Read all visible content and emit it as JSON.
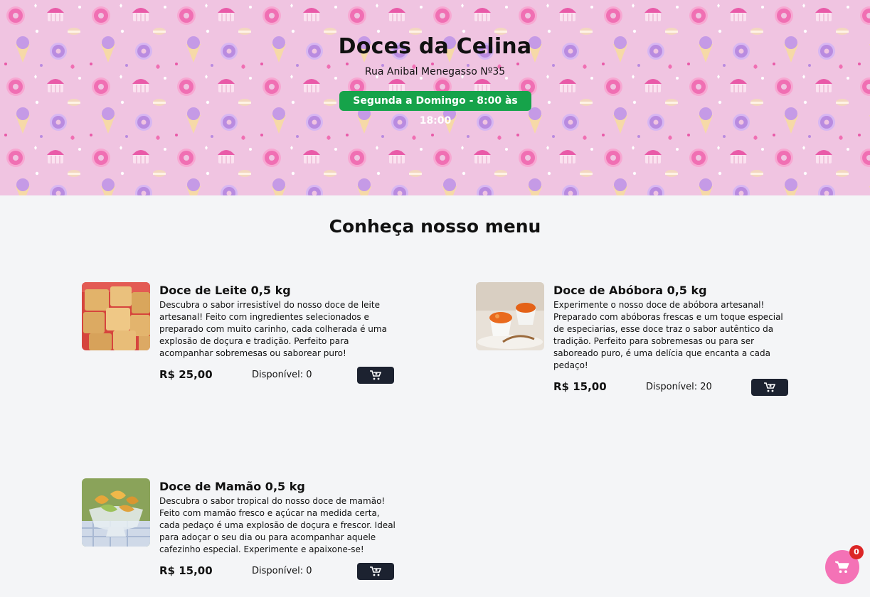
{
  "header": {
    "title": "Doces da Celina",
    "address": "Rua Anibal Menegasso Nº35",
    "hours": "Segunda a Domingo - 8:00 às 18:00"
  },
  "menu": {
    "title": "Conheça nosso menu",
    "products": [
      {
        "name": "Doce de Leite 0,5 kg",
        "description": "Descubra o sabor irresistível do nosso doce de leite artesanal! Feito com ingredientes selecionados e preparado com muito carinho, cada colherada é uma explosão de doçura e tradição. Perfeito para acompanhar sobremesas ou saborear puro!",
        "price": "R$ 25,00",
        "stock": "Disponível: 0",
        "image": "doce-de-leite-photo"
      },
      {
        "name": "Doce de Abóbora 0,5 kg",
        "description": "Experimente o nosso doce de abóbora artesanal! Preparado com abóboras frescas e um toque especial de especiarias, esse doce traz o sabor autêntico da tradição. Perfeito para sobremesas ou para ser saboreado puro, é uma delícia que encanta a cada pedaço!",
        "price": "R$ 15,00",
        "stock": "Disponível: 20",
        "image": "doce-de-abobora-photo"
      },
      {
        "name": "Doce de Mamão 0,5 kg",
        "description": "Descubra o sabor tropical do nosso doce de mamão! Feito com mamão fresco e açúcar na medida certa, cada pedaço é uma explosão de doçura e frescor. Ideal para adoçar o seu dia ou para acompanhar aquele cafezinho especial. Experimente e apaixone-se!",
        "price": "R$ 15,00",
        "stock": "Disponível: 0",
        "image": "doce-de-mamao-photo"
      }
    ]
  },
  "cart": {
    "count": "0",
    "icon": "shopping-cart-icon"
  },
  "colors": {
    "hero_background": "#f0c4e1",
    "hours_badge": "#16a34a",
    "button_dark": "#1c2230",
    "cart_fab": "#f472b6",
    "cart_badge": "#dc2626"
  }
}
